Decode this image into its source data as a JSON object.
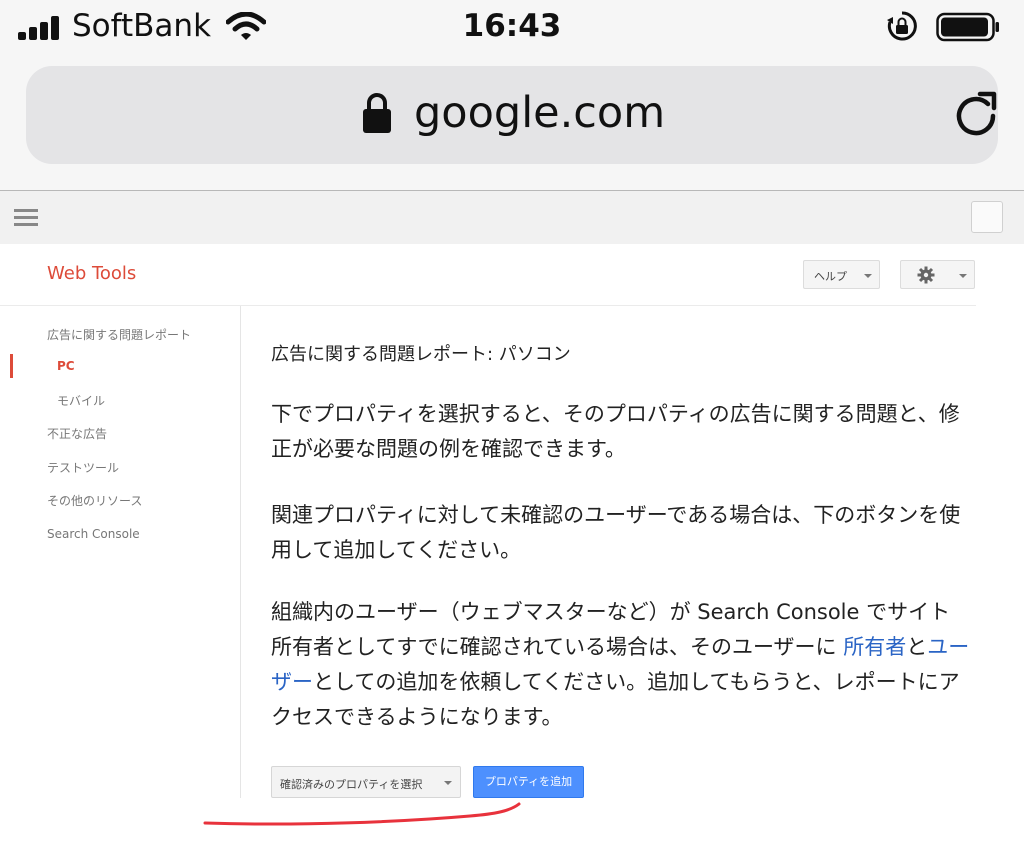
{
  "status_bar": {
    "carrier": "SoftBank",
    "time": "16:43"
  },
  "browser": {
    "url": "google.com"
  },
  "header": {
    "app_title": "Web Tools",
    "help_label": "ヘルプ"
  },
  "nav": {
    "items": [
      {
        "label": "広告に関する問題レポート"
      },
      {
        "label": "PC"
      },
      {
        "label": "モバイル"
      },
      {
        "label": "不正な広告"
      },
      {
        "label": "テストツール"
      },
      {
        "label": "その他のリソース"
      },
      {
        "label": "Search Console"
      }
    ]
  },
  "main": {
    "heading": "広告に関する問題レポート: パソコン",
    "para1": "下でプロパティを選択すると、そのプロパティの広告に関する問題と、修正が必要な問題の例を確認できます。",
    "para2": "関連プロパティに対して未確認のユーザーである場合は、下のボタンを使用して追加してください。",
    "para3_part1": "組織内のユーザー（ウェブマスターなど）が Search Console でサイト所有者としてすでに確認されている場合は、そのユーザーに ",
    "para3_link1": "所有者",
    "para3_part2": "と",
    "para3_link2": "ユーザー",
    "para3_part3": "としての追加を依頼してください。追加してもらうと、レポートにアクセスできるようになります。",
    "select_label": "確認済みのプロパティを選択",
    "add_button": "プロパティを追加"
  },
  "colors": {
    "accent_red": "#dd4b39",
    "link_blue": "#2a64c5",
    "button_blue": "#4d90fe",
    "annotation_red": "#e8323c"
  }
}
